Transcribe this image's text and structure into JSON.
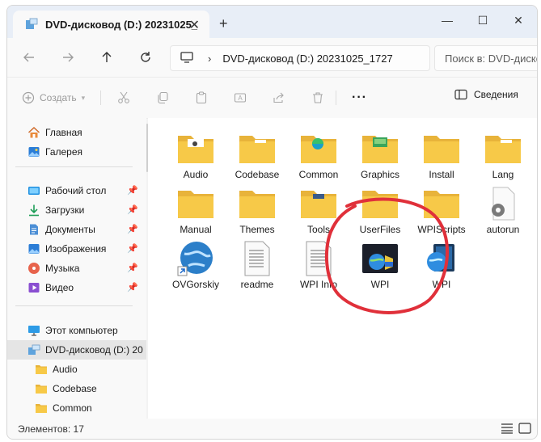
{
  "window": {
    "tab_title": "DVD-дисковод (D:) 20231025_",
    "tab_close": "✕",
    "new_tab": "+",
    "minimize": "—",
    "maximize": "☐",
    "close": "✕"
  },
  "nav": {
    "address_text": "DVD-дисковод (D:) 20231025_1727",
    "search_placeholder": "Поиск в: DVD-диско"
  },
  "toolbar": {
    "create_label": "Создать",
    "details_label": "Сведения"
  },
  "sidebar": {
    "quick": [
      {
        "label": "Главная",
        "icon": "home-icon"
      },
      {
        "label": "Галерея",
        "icon": "gallery-icon"
      }
    ],
    "pinned": [
      {
        "label": "Рабочий стол",
        "icon": "desktop-folder-icon"
      },
      {
        "label": "Загрузки",
        "icon": "downloads-icon"
      },
      {
        "label": "Документы",
        "icon": "documents-icon"
      },
      {
        "label": "Изображения",
        "icon": "pictures-icon"
      },
      {
        "label": "Музыка",
        "icon": "music-icon"
      },
      {
        "label": "Видео",
        "icon": "videos-icon"
      }
    ],
    "computer_label": "Этот компьютер",
    "drive_label": "DVD-дисковод (D:) 20",
    "children": [
      "Audio",
      "Codebase",
      "Common"
    ]
  },
  "content": {
    "items": [
      {
        "label": "Audio",
        "type": "folder",
        "badge": "audio"
      },
      {
        "label": "Codebase",
        "type": "folder",
        "badge": "plain"
      },
      {
        "label": "Common",
        "type": "folder",
        "badge": "edge"
      },
      {
        "label": "Graphics",
        "type": "folder",
        "badge": "graphics"
      },
      {
        "label": "Install",
        "type": "folder",
        "badge": "plain"
      },
      {
        "label": "Lang",
        "type": "folder",
        "badge": "plain"
      },
      {
        "label": "Manual",
        "type": "folder",
        "badge": "plain"
      },
      {
        "label": "Themes",
        "type": "folder",
        "badge": "plain"
      },
      {
        "label": "Tools",
        "type": "folder",
        "badge": "tools"
      },
      {
        "label": "UserFiles",
        "type": "folder",
        "badge": "plain"
      },
      {
        "label": "WPIScripts",
        "type": "folder",
        "badge": "plain"
      },
      {
        "label": "autorun",
        "type": "gearfile",
        "badge": ""
      },
      {
        "label": "OVGorskiy",
        "type": "globe",
        "badge": ""
      },
      {
        "label": "readme",
        "type": "doc",
        "badge": ""
      },
      {
        "label": "WPI Info",
        "type": "doc",
        "badge": ""
      },
      {
        "label": "WPI",
        "type": "wpiapp",
        "badge": ""
      },
      {
        "label": "WPI",
        "type": "wpiapp2",
        "badge": ""
      }
    ]
  },
  "status": {
    "count": "Элементов: 17"
  },
  "colors": {
    "folder": "#f7c948",
    "folder_dark": "#e8b33a",
    "accent": "#0078d4",
    "annotation": "#e0303a"
  }
}
